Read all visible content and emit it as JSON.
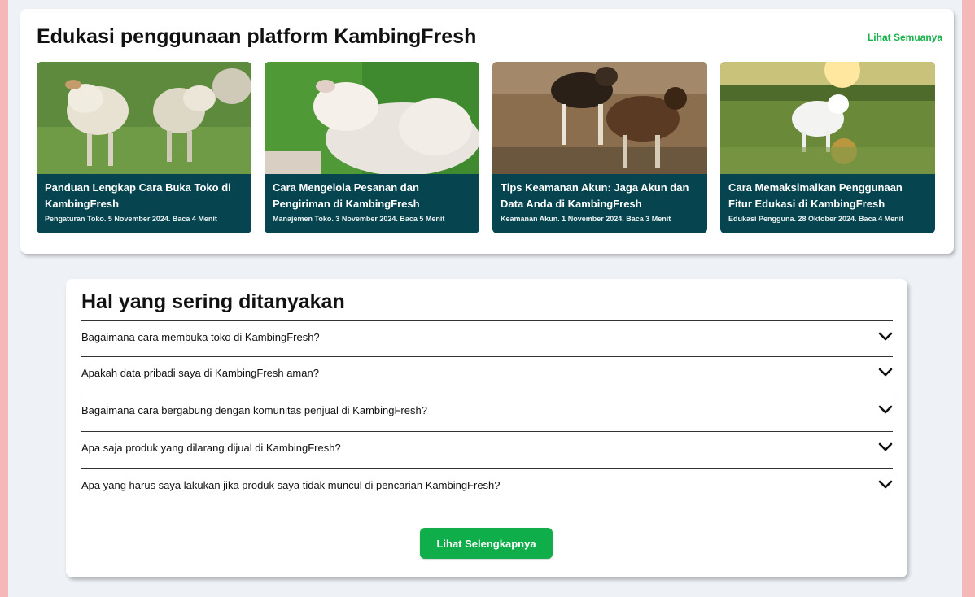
{
  "education": {
    "title": "Edukasi penggunaan platform KambingFresh",
    "see_all_label": "Lihat Semuanya",
    "articles": [
      {
        "title": "Panduan Lengkap Cara Buka Toko di KambingFresh",
        "meta": "Pengaturan Toko. 5 November 2024. Baca 4 Menit"
      },
      {
        "title": "Cara Mengelola Pesanan dan Pengiriman di KambingFresh",
        "meta": "Manajemen Toko. 3 November 2024. Baca 5 Menit"
      },
      {
        "title": "Tips Keamanan Akun: Jaga Akun dan Data Anda di KambingFresh",
        "meta": "Keamanan Akun. 1 November 2024. Baca 3 Menit"
      },
      {
        "title": "Cara Memaksimalkan Penggunaan Fitur Edukasi di KambingFresh",
        "meta": "Edukasi Pengguna. 28 Oktober 2024. Baca 4 Menit"
      }
    ]
  },
  "faq": {
    "title": "Hal yang sering ditanyakan",
    "questions": [
      "Bagaimana cara membuka toko di KambingFresh?",
      "Apakah data pribadi saya di KambingFresh aman?",
      "Bagaimana cara bergabung dengan komunitas penjual di KambingFresh?",
      "Apa saja produk yang dilarang dijual di KambingFresh?",
      "Apa yang harus saya lakukan jika produk saya tidak muncul di pencarian KambingFresh?"
    ],
    "more_label": "Lihat Selengkapnya"
  },
  "icons": {
    "faq_toggle": "chevron-down-icon"
  },
  "colors": {
    "accent_green": "#16b24a",
    "card_bg": "#064550"
  }
}
